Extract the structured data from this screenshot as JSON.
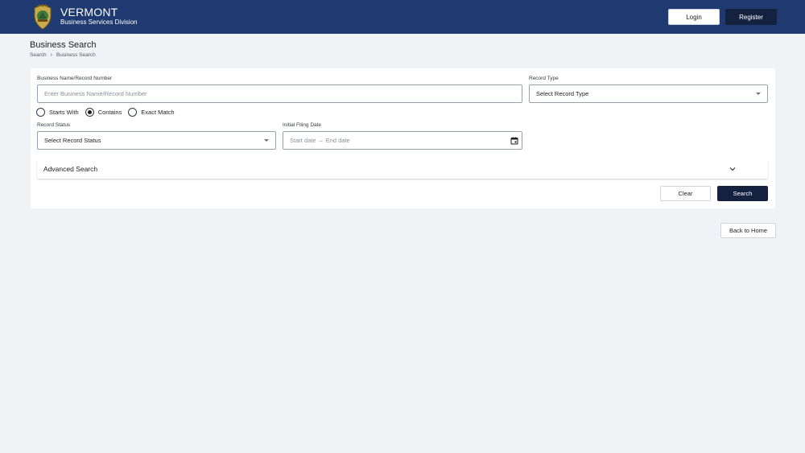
{
  "header": {
    "title": "VERMONT",
    "subtitle": "Business Services Division",
    "login_label": "Login",
    "register_label": "Register",
    "seal_icon": "state-seal-icon",
    "background": "#1f3a70"
  },
  "page": {
    "title": "Business Search",
    "breadcrumb": [
      "Search",
      "Business Search"
    ]
  },
  "form": {
    "business_name": {
      "label": "Business Name/Record Number",
      "placeholder": "Enter Business Name/Record Number",
      "value": ""
    },
    "record_type": {
      "label": "Record Type",
      "selected": "Select Record Type"
    },
    "match_options": [
      "Starts With",
      "Contains",
      "Exact Match"
    ],
    "match_selected": "Contains",
    "record_status": {
      "label": "Record Status",
      "selected": "Select Record Status"
    },
    "filing_date": {
      "label": "Initial Filing Date",
      "start_placeholder": "Start date",
      "separator": "–",
      "end_placeholder": "End date"
    },
    "advanced_search_label": "Advanced Search",
    "clear_label": "Clear",
    "search_label": "Search"
  },
  "footer": {
    "back_label": "Back to Home"
  },
  "colors": {
    "primary_dark": "#14213f",
    "page_bg": "#f1f2f6",
    "border": "#9aa0aa"
  }
}
